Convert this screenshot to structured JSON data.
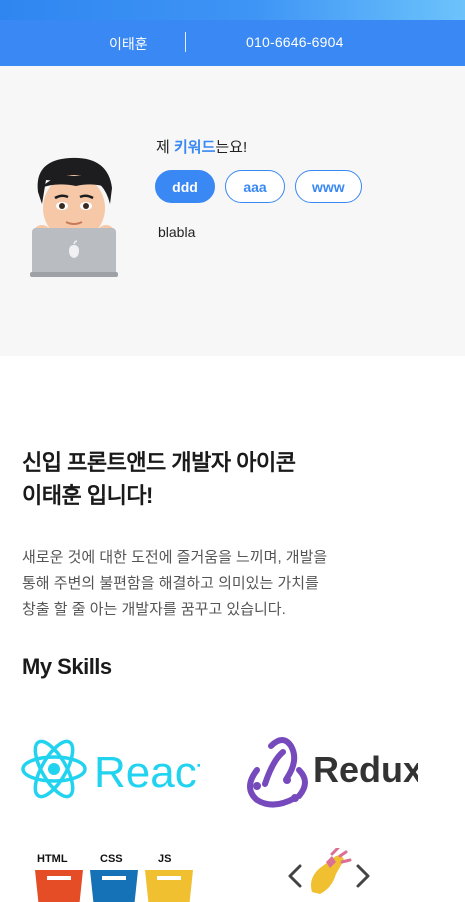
{
  "header": {
    "name": "이태훈",
    "phone": "010-6646-6904"
  },
  "profile": {
    "keyword_title_prefix": "제 ",
    "keyword_title_highlight": "키워드",
    "keyword_title_suffix": "는요!",
    "keywords": [
      {
        "label": "ddd",
        "active": true
      },
      {
        "label": "aaa",
        "active": false
      },
      {
        "label": "www",
        "active": false
      }
    ],
    "description": "blabla"
  },
  "intro": {
    "title_line1": "신입 프론트앤드 개발자 아이콘",
    "title_line2": "이태훈 입니다!",
    "body_line1": "새로운 것에 대한 도전에 즐거움을 느끼며, 개발을",
    "body_line2": "통해 주변의 불편함을 해결하고 의미있는 가치를",
    "body_line3": "창출 할 줄 아는 개발자를 꿈꾸고 있습니다."
  },
  "skills": {
    "title": "My Skills",
    "items": [
      {
        "name": "React",
        "icon": "react-icon"
      },
      {
        "name": "Redux",
        "icon": "redux-icon"
      },
      {
        "name": "HTML CSS JS",
        "labels": [
          "HTML",
          "CSS",
          "JS"
        ],
        "icon": "html-css-js-icon"
      },
      {
        "name": "styled-components",
        "icon": "styled-components-icon"
      }
    ]
  },
  "colors": {
    "accent": "#3a88f3",
    "react": "#22d3f0",
    "redux": "#764abc",
    "html": "#e44d26",
    "css": "#1572b6",
    "js": "#f0c030"
  }
}
